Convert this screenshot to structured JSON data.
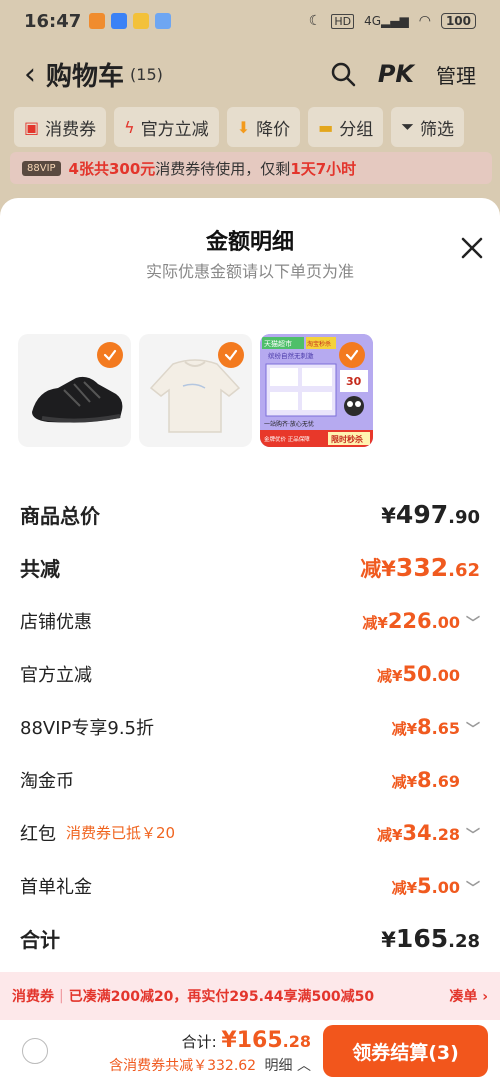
{
  "status_bar": {
    "time": "16:47",
    "icons": [
      "moon-icon",
      "hd-icon",
      "4g-signal-icon",
      "wifi-icon"
    ],
    "battery": "100"
  },
  "header": {
    "title": "购物车",
    "count": "(15)",
    "pk": "PK",
    "manage": "管理"
  },
  "filters": [
    {
      "label": "消费券",
      "icon": "coupon-icon"
    },
    {
      "label": "官方立减",
      "icon": "lightning-icon"
    },
    {
      "label": "降价",
      "icon": "price-down-icon"
    },
    {
      "label": "分组",
      "icon": "folder-icon"
    },
    {
      "label": "筛选",
      "icon": "filter-icon"
    }
  ],
  "coupon_banner": {
    "badge": "88VIP",
    "highlight": "4张共300元",
    "text": "消费券待使用，仅剩",
    "time": "1天7小时"
  },
  "sheet": {
    "title": "金额明细",
    "subtitle": "实际优惠金额请以下单页为准"
  },
  "products": [
    {
      "name": "black-sneaker"
    },
    {
      "name": "cream-sweatshirt"
    },
    {
      "name": "tissue-pack",
      "tags": [
        "天猫超市",
        "淘宝秒杀",
        "缤纷自然无刺激",
        "30",
        "一站购齐·放心无忧",
        "金牌优价 正品保障",
        "限时秒杀"
      ]
    }
  ],
  "rows": [
    {
      "label": "商品总价",
      "prefix": "¥",
      "int": "497",
      "dec": ".90",
      "style": "black-big"
    },
    {
      "label": "共减",
      "prefix": "减¥",
      "int": "332",
      "dec": ".62",
      "style": "orange-big"
    },
    {
      "label": "店铺优惠",
      "prefix": "减¥",
      "int": "226",
      "dec": ".00",
      "chevron": true
    },
    {
      "label": "官方立减",
      "prefix": "减¥",
      "int": "50",
      "dec": ".00",
      "chevron": false
    },
    {
      "label": "88VIP专享9.5折",
      "prefix": "减¥",
      "int": "8",
      "dec": ".65",
      "chevron": true
    },
    {
      "label": "淘金币",
      "prefix": "减¥",
      "int": "8",
      "dec": ".69",
      "chevron": false
    },
    {
      "label": "红包",
      "note": "消费券已抵￥20",
      "prefix": "减¥",
      "int": "34",
      "dec": ".28",
      "chevron": true
    },
    {
      "label": "首单礼金",
      "prefix": "减¥",
      "int": "5",
      "dec": ".00",
      "chevron": true
    },
    {
      "label": "合计",
      "prefix": "¥",
      "int": "165",
      "dec": ".28",
      "style": "black-total"
    }
  ],
  "promo": {
    "tag": "消费券",
    "text": "已凑满200减20，再实付295.44享满500减50",
    "link": "凑单 ›"
  },
  "bottom": {
    "total_label": "合计:",
    "total_int": "¥165",
    "total_dec": ".28",
    "discount": "含消费券共减￥332.62",
    "detail": "明细",
    "checkout": "领券结算(3)"
  },
  "colors": {
    "accent": "#f2561c",
    "discount": "#f05a1f",
    "promo_bg": "#fde8ea",
    "promo_text": "#e3352c"
  }
}
